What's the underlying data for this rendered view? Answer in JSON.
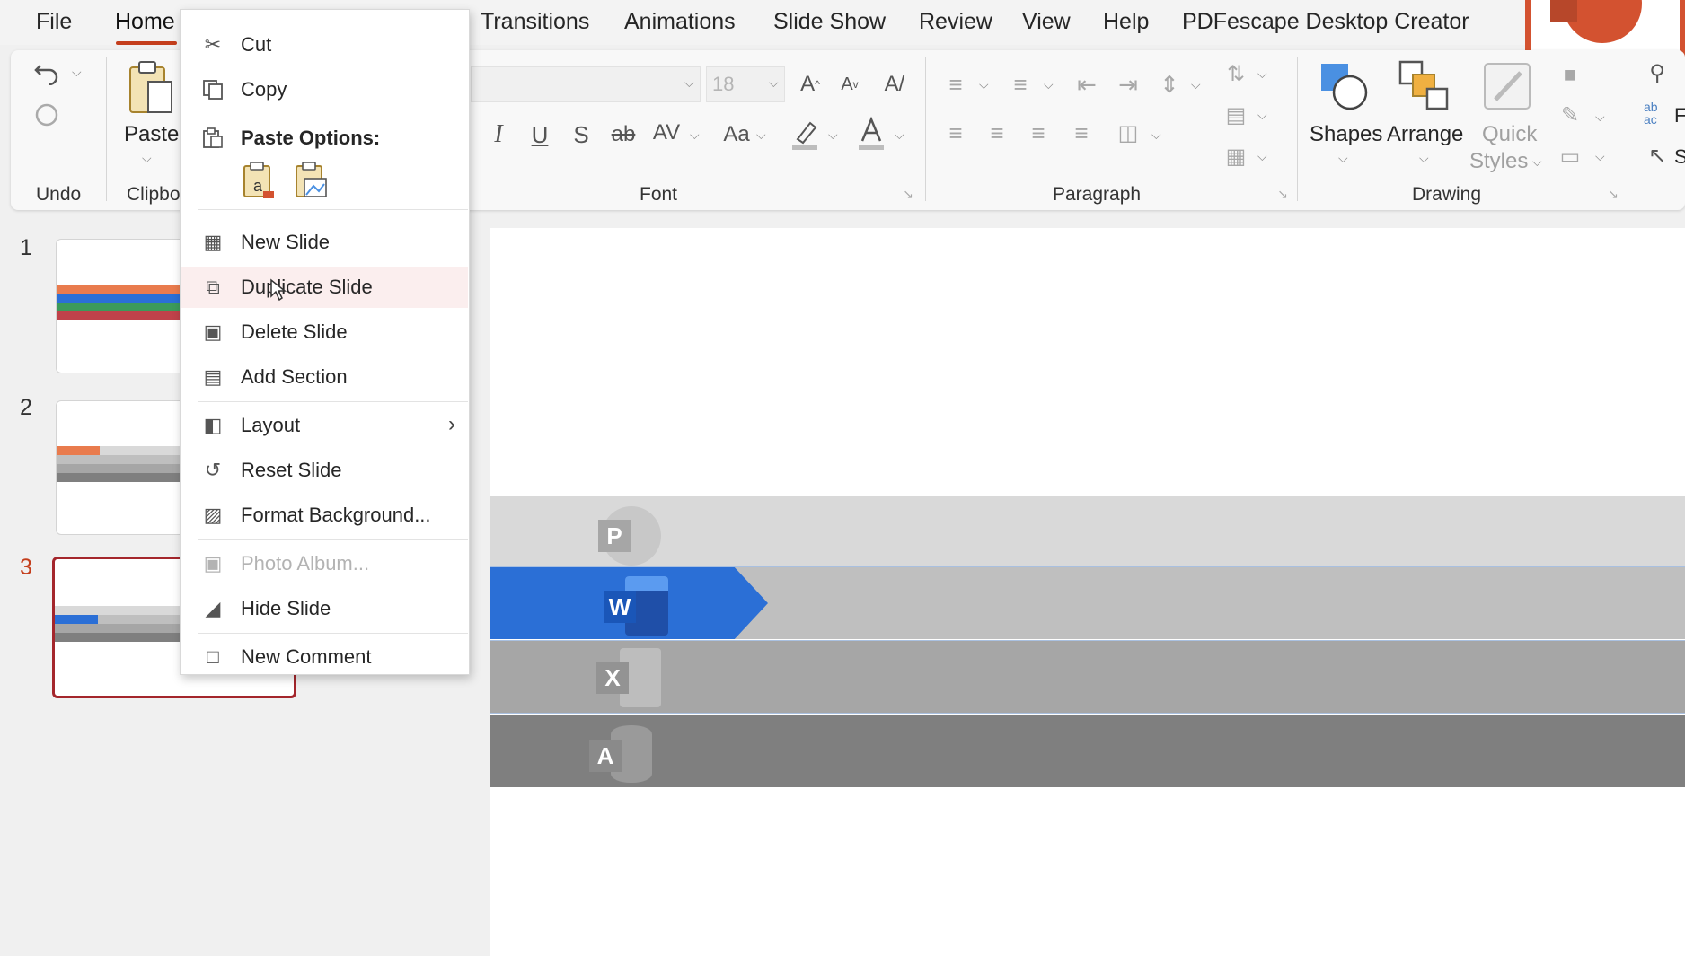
{
  "tabs": [
    "File",
    "Home",
    "Transitions",
    "Animations",
    "Slide Show",
    "Review",
    "View",
    "Help",
    "PDFescape Desktop Creator"
  ],
  "ribbon": {
    "undo_group": "Undo",
    "clipboard_group": "Clipbo",
    "paste_label": "Paste",
    "font_group": "Font",
    "font_size": "18",
    "paragraph_group": "Paragraph",
    "drawing_group": "Drawing",
    "shapes_label": "Shapes",
    "arrange_label": "Arrange",
    "quick_label": "Quick",
    "styles_label": "Styles",
    "ab_label": "ab",
    "ac_label": "ac",
    "edit_f_label": "F",
    "edit_s_label": "S"
  },
  "slides": [
    {
      "number": "1",
      "selected": false
    },
    {
      "number": "2",
      "selected": false
    },
    {
      "number": "3",
      "selected": true
    }
  ],
  "canvas": {
    "bands": [
      {
        "letter": "P",
        "color": "#d9d9d9"
      },
      {
        "letter": "W",
        "color": "#2b6fd6"
      },
      {
        "letter": "X",
        "color": "#a6a6a6"
      },
      {
        "letter": "A",
        "color": "#7f7f7f"
      }
    ]
  },
  "context_menu": {
    "cut": "Cut",
    "copy": "Copy",
    "paste_options": "Paste Options:",
    "new_slide": "New Slide",
    "duplicate_slide": "Duplicate Slide",
    "delete_slide": "Delete Slide",
    "add_section": "Add Section",
    "layout": "Layout",
    "reset_slide": "Reset Slide",
    "format_background": "Format Background...",
    "photo_album": "Photo Album...",
    "hide_slide": "Hide Slide",
    "new_comment": "New Comment"
  },
  "colors": {
    "accent": "#c43e1c",
    "selected_border": "#a4262c",
    "word_blue": "#2b6fd6"
  }
}
